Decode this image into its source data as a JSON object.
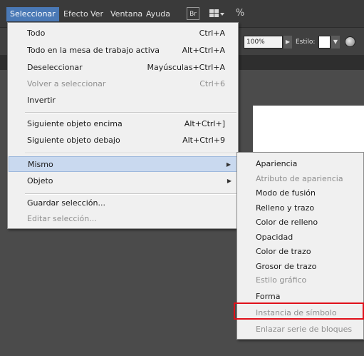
{
  "menubar": {
    "items": [
      {
        "label": "Seleccionar",
        "active": true
      },
      {
        "label": "Efecto"
      },
      {
        "label": "Ver"
      },
      {
        "label": "Ventana"
      },
      {
        "label": "Ayuda"
      }
    ],
    "icons": [
      {
        "name": "bridge-icon",
        "label": "Br"
      },
      {
        "name": "workspace-arrange-icon",
        "label": "▾"
      },
      {
        "name": "gpu-rocket-icon",
        "label": "%"
      }
    ]
  },
  "controlbar": {
    "zoom_value": "100%",
    "style_label": "Estilo:"
  },
  "menu": {
    "items": [
      {
        "label": "Todo",
        "shortcut": "Ctrl+A"
      },
      {
        "label": "Todo en la mesa de trabajo activa",
        "shortcut": "Alt+Ctrl+A"
      },
      {
        "label": "Deseleccionar",
        "shortcut": "Mayúsculas+Ctrl+A"
      },
      {
        "label": "Volver a seleccionar",
        "shortcut": "Ctrl+6",
        "disabled": true
      },
      {
        "label": "Invertir",
        "shortcut": ""
      },
      {
        "label": "Siguiente objeto encima",
        "shortcut": "Alt+Ctrl+]"
      },
      {
        "label": "Siguiente objeto debajo",
        "shortcut": "Alt+Ctrl+9"
      },
      {
        "label": "Mismo",
        "submenu": true,
        "highlighted": true
      },
      {
        "label": "Objeto",
        "submenu": true
      },
      {
        "label": "Guardar selección..."
      },
      {
        "label": "Editar selección...",
        "disabled": true
      }
    ]
  },
  "submenu": {
    "items": [
      {
        "label": "Apariencia"
      },
      {
        "label": "Atributo de apariencia",
        "disabled": true
      },
      {
        "label": "Modo de fusión"
      },
      {
        "label": "Relleno y trazo"
      },
      {
        "label": "Color de relleno"
      },
      {
        "label": "Opacidad"
      },
      {
        "label": "Color de trazo"
      },
      {
        "label": "Grosor de trazo"
      },
      {
        "label": "Estilo gráfico",
        "disabled": true
      },
      {
        "label": "Forma",
        "outlined": true
      },
      {
        "label": "Instancia de símbolo",
        "disabled": true
      },
      {
        "label": "Enlazar serie de bloques",
        "disabled": true
      }
    ]
  },
  "colors": {
    "menubar_active": "#4a79b6",
    "menu_highlight": "#c9d9ef",
    "annotation_outline": "#e0101a"
  }
}
